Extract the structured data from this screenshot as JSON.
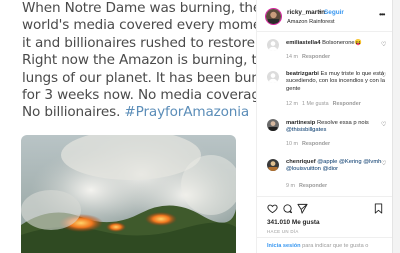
{
  "post_image": {
    "tweet_lines": [
      "When Notre Dame was burning, the",
      "world's media covered every moment of",
      "it and billionaires rushed to restore it.",
      "Right now the Amazon is burning, the",
      "lungs of our planet. It has been burning",
      "for 3 weeks now. No media coverage.",
      "No billionaires."
    ],
    "hashtag": "#PrayforAmazonia"
  },
  "header": {
    "username": "ricky_martin",
    "separator": "•",
    "follow_label": "Seguir",
    "location": "Amazon Rainforest",
    "more_icon": "more-options-icon"
  },
  "comments": [
    {
      "username": "emiliastella4",
      "text": "Bolsonerone😝",
      "time": "14 m",
      "likes": "",
      "reply": "Responder"
    },
    {
      "username": "beatrizgarbi",
      "text": "Es muy triste lo que está sucediendo, con los incendios y con la gente",
      "time": "12 m",
      "likes": "1 Me gusta",
      "reply": "Responder"
    },
    {
      "username": "martinesip",
      "text": "Resolve essa p nois",
      "mention": "@thisisbillgates",
      "time": "10 m",
      "likes": "",
      "reply": "Responder"
    },
    {
      "username": "chenriquef",
      "text_parts": [
        "@apple",
        "@Kering",
        "@lvmh",
        "@louisvuitton",
        "@dior"
      ],
      "time": "9 m",
      "likes": "",
      "reply": "Responder"
    }
  ],
  "actions": {
    "likes": "341.010 Me gusta",
    "date": "HACE UN DÍA",
    "login_link": "Inicia sesión",
    "login_rest": " para indicar que te gusta o"
  },
  "colors": {
    "link_blue": "#3897f0",
    "hashtag_blue": "#5b8db8",
    "muted": "#999999",
    "text": "#262626"
  }
}
